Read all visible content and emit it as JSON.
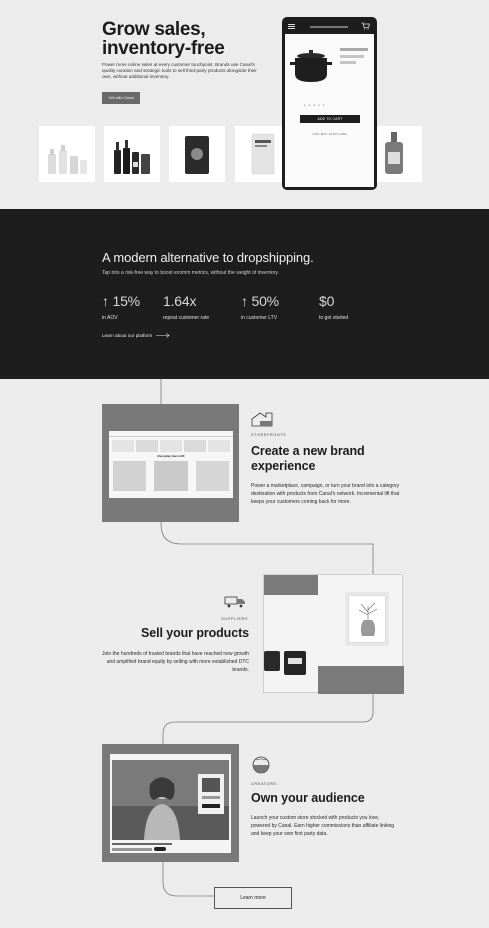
{
  "hero": {
    "title": "Grow sales, inventory-free",
    "subtitle": "Power more online sales at every customer touchpoint. Brands use Canal's quality curation and strategic tools to sell third-party products alongside their own, without additional inventory.",
    "cta_label": "Sell with Canal"
  },
  "phone": {
    "add_to_cart": "ADD TO CART",
    "also_like": "YOU MAY ALSO LIKE"
  },
  "dark": {
    "title": "A modern alternative to dropshipping.",
    "subtitle": "Tap into a risk-free way to boost ecomm metrics, without the weight of inventory.",
    "stats": [
      {
        "value": "↑ 15%",
        "label": "in AOV"
      },
      {
        "value": "1.64x",
        "label": "repeat customer rate"
      },
      {
        "value": "↑ 50%",
        "label": "in customer LTV"
      },
      {
        "value": "$0",
        "label": "to get started"
      }
    ],
    "link": "Learn about our platform"
  },
  "storefronts": {
    "eyebrow": "STOREFRONTS",
    "title": "Create a new brand experience",
    "desc": "Power a marketplace, campaign, or turn your brand into a category destination with products from Canal's network. Incremental lift that keeps your customers coming back for more.",
    "mock_heading": "Everyday Hero Gift"
  },
  "suppliers": {
    "eyebrow": "SUPPLIERS",
    "title": "Sell your products",
    "desc": "Join the hundreds of trusted brands that have reached new growth and amplified brand equity by selling with more established DTC brands."
  },
  "creators": {
    "eyebrow": "CREATORS",
    "title": "Own your audience",
    "desc": "Launch your custom store stocked with products you love, powered by Canal. Earn higher commissions than affiliate linking and keep your own first party data."
  },
  "more_label": "Learn more"
}
